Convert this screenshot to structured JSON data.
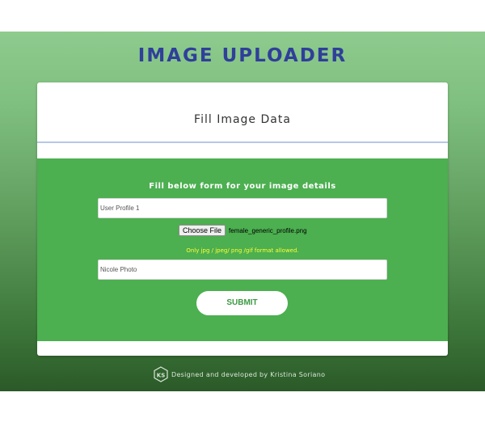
{
  "app": {
    "title": "IMAGE UPLOADER"
  },
  "card": {
    "header_title": "Fill Image Data",
    "form": {
      "intro": "Fill below form for your image details",
      "title_field": {
        "value": "User Profile 1",
        "placeholder": ""
      },
      "file_input": {
        "button_label": "Choose File",
        "file_name": "female_generic_profile.png"
      },
      "format_note": "Only jpg / jpeg/ png /gif format allowed.",
      "name_field": {
        "value": "Nicole Photo",
        "placeholder": ""
      },
      "submit_label": "SUBMIT"
    }
  },
  "footer": {
    "logo_text": "KS",
    "text": "Designed and developed by Kristina Soriano"
  },
  "colors": {
    "title": "#2f3f9a",
    "form_panel": "#4caf50",
    "format_note": "#ffff33",
    "submit_text": "#3a9a40"
  }
}
